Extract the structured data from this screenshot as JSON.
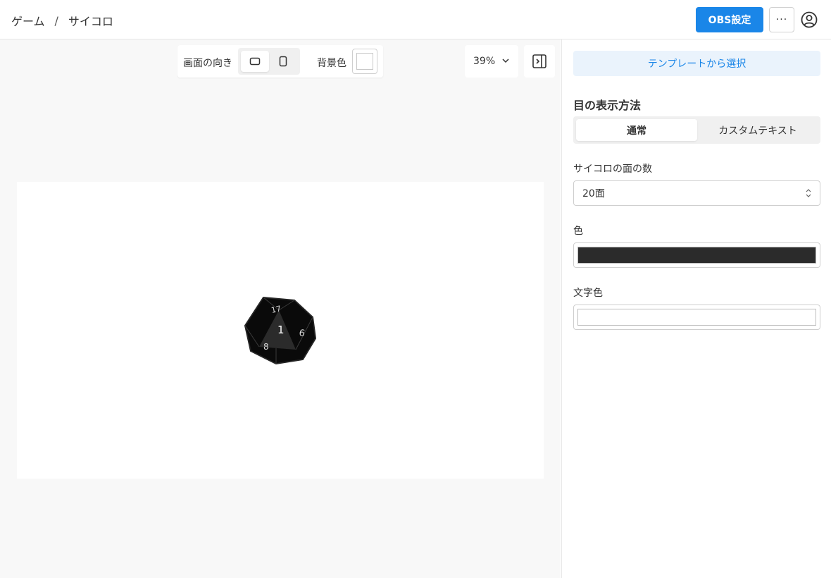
{
  "header": {
    "breadcrumb": [
      "ゲーム",
      "サイコロ"
    ],
    "breadcrumb_separator": "/",
    "obs_button": "OBS設定",
    "more_button": "···",
    "accent_color": "#1a86e8"
  },
  "toolbar": {
    "orientation_label": "画面の向き",
    "orientation_options": [
      "landscape",
      "portrait"
    ],
    "orientation_selected": "landscape",
    "bg_color_label": "背景色",
    "bg_color_value": "#ffffff",
    "zoom": "39%"
  },
  "preview": {
    "dice_faces_visible": [
      "17",
      "1",
      "6",
      "8"
    ],
    "dice_color": "#2b2b2b",
    "dice_text_color": "#ffffff"
  },
  "side_panel": {
    "template_button": "テンプレートから選択",
    "pip_display_title": "目の表示方法",
    "pip_display_options": [
      "通常",
      "カスタムテキスト"
    ],
    "pip_display_selected": "通常",
    "faces_label": "サイコロの面の数",
    "faces_value": "20面",
    "color_label": "色",
    "color_value": "#2b2b2b",
    "text_color_label": "文字色",
    "text_color_value": "#ffffff"
  }
}
